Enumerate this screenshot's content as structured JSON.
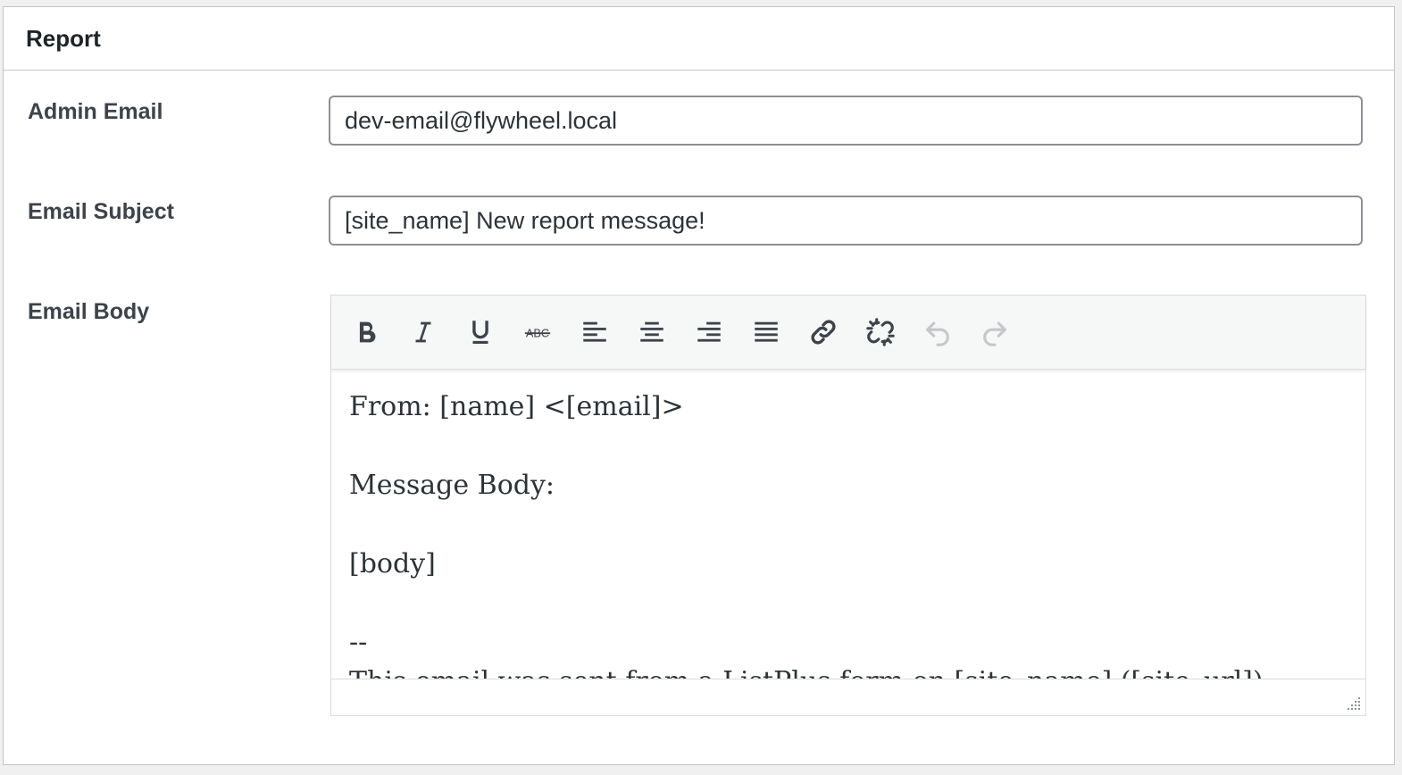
{
  "panel": {
    "title": "Report"
  },
  "fields": {
    "admin_email": {
      "label": "Admin Email",
      "value": "dev-email@flywheel.local"
    },
    "email_subject": {
      "label": "Email Subject",
      "value": "[site_name] New report message!"
    },
    "email_body": {
      "label": "Email Body"
    }
  },
  "editor": {
    "toolbar": [
      {
        "icon": "bold-icon"
      },
      {
        "icon": "italic-icon"
      },
      {
        "icon": "underline-icon"
      },
      {
        "icon": "strikethrough-icon"
      },
      {
        "icon": "align-left-icon"
      },
      {
        "icon": "align-center-icon"
      },
      {
        "icon": "align-right-icon"
      },
      {
        "icon": "align-justify-icon"
      },
      {
        "icon": "link-icon"
      },
      {
        "icon": "unlink-icon"
      },
      {
        "icon": "undo-icon"
      },
      {
        "icon": "redo-icon"
      }
    ],
    "content": {
      "line1": "From: [name] <[email]>",
      "line2": "Message Body:",
      "line3": "[body]",
      "line4": "--",
      "line5": "This email was sent from a ListPlus form on [site_name] ([site_url])"
    }
  }
}
